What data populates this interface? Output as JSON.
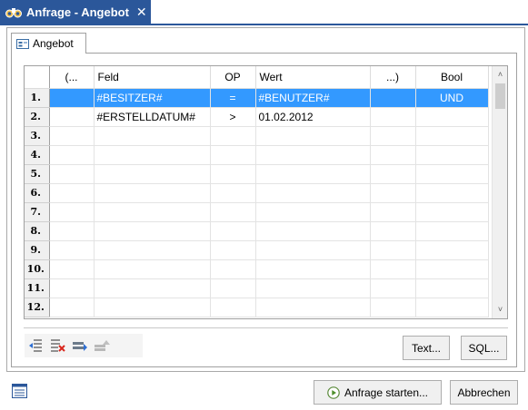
{
  "window": {
    "title": "Anfrage - Angebot",
    "close_glyph": "✕",
    "icon": "binoculars-icon"
  },
  "page_tab": {
    "label": "Angebot",
    "icon": "form-icon"
  },
  "grid": {
    "columns": [
      "(...",
      "Feld",
      "OP",
      "Wert",
      "...)",
      "Bool"
    ],
    "rows": [
      {
        "num": "1.",
        "open": "",
        "feld": "#BESITZER#",
        "op": "=",
        "wert": "#BENUTZER#",
        "close": "",
        "bool": "UND",
        "selected": true
      },
      {
        "num": "2.",
        "open": "",
        "feld": "#ERSTELLDATUM#",
        "op": ">",
        "wert": "01.02.2012",
        "close": "",
        "bool": ""
      },
      {
        "num": "3.",
        "open": "",
        "feld": "",
        "op": "",
        "wert": "",
        "close": "",
        "bool": ""
      },
      {
        "num": "4.",
        "open": "",
        "feld": "",
        "op": "",
        "wert": "",
        "close": "",
        "bool": ""
      },
      {
        "num": "5.",
        "open": "",
        "feld": "",
        "op": "",
        "wert": "",
        "close": "",
        "bool": ""
      },
      {
        "num": "6.",
        "open": "",
        "feld": "",
        "op": "",
        "wert": "",
        "close": "",
        "bool": ""
      },
      {
        "num": "7.",
        "open": "",
        "feld": "",
        "op": "",
        "wert": "",
        "close": "",
        "bool": ""
      },
      {
        "num": "8.",
        "open": "",
        "feld": "",
        "op": "",
        "wert": "",
        "close": "",
        "bool": ""
      },
      {
        "num": "9.",
        "open": "",
        "feld": "",
        "op": "",
        "wert": "",
        "close": "",
        "bool": ""
      },
      {
        "num": "10.",
        "open": "",
        "feld": "",
        "op": "",
        "wert": "",
        "close": "",
        "bool": ""
      },
      {
        "num": "11.",
        "open": "",
        "feld": "",
        "op": "",
        "wert": "",
        "close": "",
        "bool": ""
      },
      {
        "num": "12.",
        "open": "",
        "feld": "",
        "op": "",
        "wert": "",
        "close": "",
        "bool": ""
      }
    ],
    "scroll_up_glyph": "˄",
    "scroll_down_glyph": "˅"
  },
  "toolbar": {
    "icons": [
      "insert-row-icon",
      "delete-row-icon",
      "move-down-icon",
      "move-up-icon"
    ],
    "text_button": "Text...",
    "sql_button": "SQL..."
  },
  "footer": {
    "start_button": "Anfrage starten...",
    "cancel_button": "Abbrechen",
    "left_icon": "list-view-icon"
  },
  "colors": {
    "accent": "#2b579a",
    "selection": "#3399ff"
  }
}
